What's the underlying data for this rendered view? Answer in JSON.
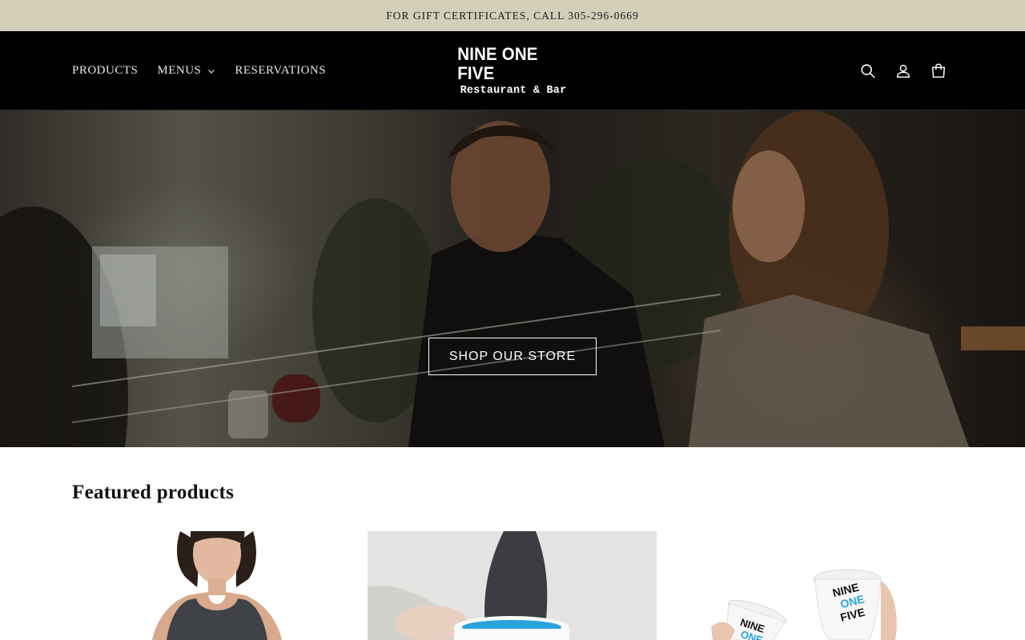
{
  "announcement": {
    "text": "FOR GIFT CERTIFICATES, CALL 305-296-0669"
  },
  "header": {
    "nav": [
      {
        "label": "PRODUCTS"
      },
      {
        "label": "MENUS"
      },
      {
        "label": "RESERVATIONS"
      }
    ],
    "logo": {
      "line1": "NINE ONE FIVE",
      "line2": "Restaurant & Bar"
    },
    "icons": [
      "search-icon",
      "account-icon",
      "cart-icon"
    ]
  },
  "hero": {
    "button_label": "SHOP OUR STORE"
  },
  "featured": {
    "title": "Featured products",
    "mug_logo_lines": [
      "NINE",
      "ONE",
      "FIVE"
    ]
  },
  "colors": {
    "announcement_bg": "#d3cfb9",
    "header_bg": "#000000",
    "accent_blue": "#2aa3dc"
  }
}
